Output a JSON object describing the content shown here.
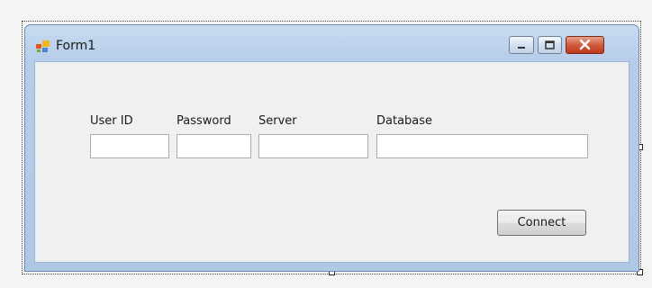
{
  "window": {
    "title": "Form1"
  },
  "form": {
    "fields": [
      {
        "label": "User ID",
        "value": ""
      },
      {
        "label": "Password",
        "value": ""
      },
      {
        "label": "Server",
        "value": ""
      },
      {
        "label": "Database",
        "value": ""
      }
    ],
    "connect_label": "Connect"
  },
  "icons": {
    "app": "app-form-icon",
    "minimize": "minimize-icon",
    "maximize": "maximize-icon",
    "close": "close-icon"
  },
  "colors": {
    "titlebar": "#b6cde9",
    "close_button": "#c1391d",
    "client_background": "#f0f0f0"
  }
}
